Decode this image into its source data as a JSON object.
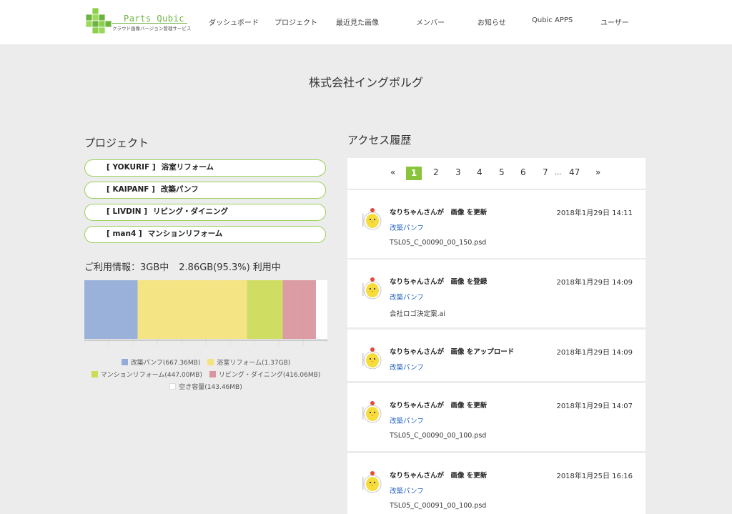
{
  "header": {
    "logo_title": "Parts Qubic",
    "logo_subtitle": "クラウド画像バージョン管理サービス",
    "nav": [
      {
        "label": "ダッシュボード"
      },
      {
        "label": "プロジェクト"
      },
      {
        "label": "最近見た画像"
      },
      {
        "label": "メンバー"
      },
      {
        "label": "お知らせ"
      },
      {
        "label": "Qubic APPS"
      },
      {
        "label": "ユーザー"
      }
    ]
  },
  "company": {
    "name": "株式会社イングボルグ"
  },
  "projects": {
    "title": "プロジェクト",
    "items": [
      {
        "code": "[ YOKURIF ]",
        "name": "浴室リフォーム"
      },
      {
        "code": "[ KAIPANF ]",
        "name": "改築パンフ"
      },
      {
        "code": "[ LIVDIN ]",
        "name": "リビング・ダイニング"
      },
      {
        "code": "[ man4 ]",
        "name": "マンションリフォーム"
      }
    ]
  },
  "usage": {
    "label": "ご利用情報：3GB中",
    "used": "2.86GB(95.3%) 利用中"
  },
  "chart_data": {
    "type": "bar",
    "orientation": "horizontal-stacked",
    "total_gb": 3,
    "series": [
      {
        "name": "改築パンフ(667.36MB)",
        "value_mb": 667.36,
        "color": "#92abd8"
      },
      {
        "name": "浴室リフォーム(1.37GB)",
        "value_mb": 1370,
        "color": "#f4e37a"
      },
      {
        "name": "マンションリフォーム(447.00MB)",
        "value_mb": 447.0,
        "color": "#cddb57"
      },
      {
        "name": "リビング・ダイニング(416.06MB)",
        "value_mb": 416.06,
        "color": "#d9959d"
      },
      {
        "name": "空き容量(143.46MB)",
        "value_mb": 143.46,
        "color": "#ffffff"
      }
    ],
    "legend": "bottom",
    "grid": true
  },
  "history": {
    "title": "アクセス履歴",
    "pager": {
      "prev": "«",
      "pages": [
        "1",
        "2",
        "3",
        "4",
        "5",
        "6",
        "7"
      ],
      "active": "1",
      "ellipsis": "...",
      "last": "47",
      "next": "»"
    },
    "entries": [
      {
        "action": "なりちゃんさんが　画像 を更新",
        "time": "2018年1月29日 14:11",
        "project": "改築パンフ",
        "file": "TSL05_C_00090_00_150.psd"
      },
      {
        "action": "なりちゃんさんが　画像 を登録",
        "time": "2018年1月29日 14:09",
        "project": "改築パンフ",
        "file": "会社ロゴ決定案.ai"
      },
      {
        "action": "なりちゃんさんが　画像 をアップロード",
        "time": "2018年1月29日 14:09",
        "project": "改築パンフ",
        "file": ""
      },
      {
        "action": "なりちゃんさんが　画像 を更新",
        "time": "2018年1月29日 14:07",
        "project": "改築パンフ",
        "file": "TSL05_C_00090_00_100.psd"
      },
      {
        "action": "なりちゃんさんが　画像 を更新",
        "time": "2018年1月25日 16:16",
        "project": "改築パンフ",
        "file": "TSL05_C_00091_00_100.psd"
      }
    ]
  }
}
